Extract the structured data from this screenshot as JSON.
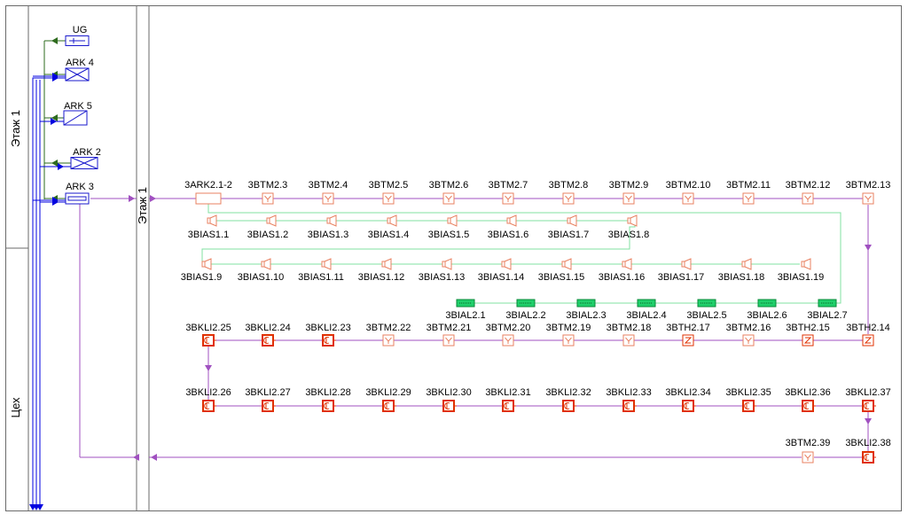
{
  "colors": {
    "frame": "#6a6a6a",
    "bus": "#0000e0",
    "green_line": "#2e6b1e",
    "purple_line": "#a050c0",
    "device_pink": "#e88060",
    "device_red": "#e03000",
    "module_green": "#1fcf6a",
    "panel_blue": "#1a1acc",
    "link_green": "#80e0a0"
  },
  "zones": {
    "floor1_left": "Этаж 1",
    "workshop": "Цех",
    "floor1_inner": "Этаж 1"
  },
  "panels": [
    "UG",
    "ARK 4",
    "ARK 5",
    "ARK 2",
    "ARK 3"
  ],
  "row_btm": [
    "3ARK2.1-2",
    "3BTM2.3",
    "3BTM2.4",
    "3BTM2.5",
    "3BTM2.6",
    "3BTM2.7",
    "3BTM2.8",
    "3BTM2.9",
    "3BTM2.10",
    "3BTM2.11",
    "3BTM2.12",
    "3BTM2.13"
  ],
  "row_ias1": [
    "3BIAS1.1",
    "3BIAS1.2",
    "3BIAS1.3",
    "3BIAS1.4",
    "3BIAS1.5",
    "3BIAS1.6",
    "3BIAS1.7",
    "3BIAS1.8"
  ],
  "row_ias2": [
    "3BIAS1.9",
    "3BIAS1.10",
    "3BIAS1.11",
    "3BIAS1.12",
    "3BIAS1.13",
    "3BIAS1.14",
    "3BIAS1.15",
    "3BIAS1.16",
    "3BIAS1.17",
    "3BIAS1.18",
    "3BIAS1.19"
  ],
  "row_ial": [
    "3BIAL2.1",
    "3BIAL2.2",
    "3BIAL2.3",
    "3BIAL2.4",
    "3BIAL2.5",
    "3BIAL2.6",
    "3BIAL2.7"
  ],
  "row_mid": [
    {
      "label": "3BKLI2.25",
      "kind": "kli"
    },
    {
      "label": "3BKLI2.24",
      "kind": "kli"
    },
    {
      "label": "3BKLI2.23",
      "kind": "kli"
    },
    {
      "label": "3BTM2.22",
      "kind": "btm"
    },
    {
      "label": "3BTM2.21",
      "kind": "btm"
    },
    {
      "label": "3BTM2.20",
      "kind": "btm"
    },
    {
      "label": "3BTM2.19",
      "kind": "btm"
    },
    {
      "label": "3BTM2.18",
      "kind": "btm"
    },
    {
      "label": "3BTH2.17",
      "kind": "bth"
    },
    {
      "label": "3BTM2.16",
      "kind": "btm"
    },
    {
      "label": "3BTH2.15",
      "kind": "bth"
    },
    {
      "label": "3BTH2.14",
      "kind": "bth"
    }
  ],
  "row_kli": [
    "3BKLI2.26",
    "3BKLI2.27",
    "3BKLI2.28",
    "3BKLI2.29",
    "3BKLI2.30",
    "3BKLI2.31",
    "3BKLI2.32",
    "3BKLI2.33",
    "3BKLI2.34",
    "3BKLI2.35",
    "3BKLI2.36",
    "3BKLI2.37"
  ],
  "row_end": [
    {
      "label": "3BTM2.39",
      "kind": "btm"
    },
    {
      "label": "3BKLI2.38",
      "kind": "kli"
    }
  ]
}
